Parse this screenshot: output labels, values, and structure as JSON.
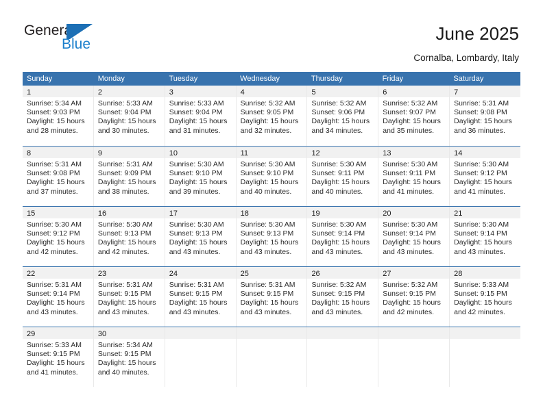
{
  "brand": {
    "name_part1": "General",
    "name_part2": "Blue"
  },
  "header": {
    "title": "June 2025",
    "subtitle": "Cornalba, Lombardy, Italy"
  },
  "colors": {
    "header_blue": "#3873ae",
    "brand_blue": "#1b7fcc",
    "daynum_band": "#f1f1f1",
    "text": "#1a1a1a"
  },
  "calendar": {
    "weekday_headers": [
      "Sunday",
      "Monday",
      "Tuesday",
      "Wednesday",
      "Thursday",
      "Friday",
      "Saturday"
    ],
    "weeks": [
      [
        {
          "day": "1",
          "sunrise": "Sunrise: 5:34 AM",
          "sunset": "Sunset: 9:03 PM",
          "daylight": "Daylight: 15 hours and 28 minutes."
        },
        {
          "day": "2",
          "sunrise": "Sunrise: 5:33 AM",
          "sunset": "Sunset: 9:04 PM",
          "daylight": "Daylight: 15 hours and 30 minutes."
        },
        {
          "day": "3",
          "sunrise": "Sunrise: 5:33 AM",
          "sunset": "Sunset: 9:04 PM",
          "daylight": "Daylight: 15 hours and 31 minutes."
        },
        {
          "day": "4",
          "sunrise": "Sunrise: 5:32 AM",
          "sunset": "Sunset: 9:05 PM",
          "daylight": "Daylight: 15 hours and 32 minutes."
        },
        {
          "day": "5",
          "sunrise": "Sunrise: 5:32 AM",
          "sunset": "Sunset: 9:06 PM",
          "daylight": "Daylight: 15 hours and 34 minutes."
        },
        {
          "day": "6",
          "sunrise": "Sunrise: 5:32 AM",
          "sunset": "Sunset: 9:07 PM",
          "daylight": "Daylight: 15 hours and 35 minutes."
        },
        {
          "day": "7",
          "sunrise": "Sunrise: 5:31 AM",
          "sunset": "Sunset: 9:08 PM",
          "daylight": "Daylight: 15 hours and 36 minutes."
        }
      ],
      [
        {
          "day": "8",
          "sunrise": "Sunrise: 5:31 AM",
          "sunset": "Sunset: 9:08 PM",
          "daylight": "Daylight: 15 hours and 37 minutes."
        },
        {
          "day": "9",
          "sunrise": "Sunrise: 5:31 AM",
          "sunset": "Sunset: 9:09 PM",
          "daylight": "Daylight: 15 hours and 38 minutes."
        },
        {
          "day": "10",
          "sunrise": "Sunrise: 5:30 AM",
          "sunset": "Sunset: 9:10 PM",
          "daylight": "Daylight: 15 hours and 39 minutes."
        },
        {
          "day": "11",
          "sunrise": "Sunrise: 5:30 AM",
          "sunset": "Sunset: 9:10 PM",
          "daylight": "Daylight: 15 hours and 40 minutes."
        },
        {
          "day": "12",
          "sunrise": "Sunrise: 5:30 AM",
          "sunset": "Sunset: 9:11 PM",
          "daylight": "Daylight: 15 hours and 40 minutes."
        },
        {
          "day": "13",
          "sunrise": "Sunrise: 5:30 AM",
          "sunset": "Sunset: 9:11 PM",
          "daylight": "Daylight: 15 hours and 41 minutes."
        },
        {
          "day": "14",
          "sunrise": "Sunrise: 5:30 AM",
          "sunset": "Sunset: 9:12 PM",
          "daylight": "Daylight: 15 hours and 41 minutes."
        }
      ],
      [
        {
          "day": "15",
          "sunrise": "Sunrise: 5:30 AM",
          "sunset": "Sunset: 9:12 PM",
          "daylight": "Daylight: 15 hours and 42 minutes."
        },
        {
          "day": "16",
          "sunrise": "Sunrise: 5:30 AM",
          "sunset": "Sunset: 9:13 PM",
          "daylight": "Daylight: 15 hours and 42 minutes."
        },
        {
          "day": "17",
          "sunrise": "Sunrise: 5:30 AM",
          "sunset": "Sunset: 9:13 PM",
          "daylight": "Daylight: 15 hours and 43 minutes."
        },
        {
          "day": "18",
          "sunrise": "Sunrise: 5:30 AM",
          "sunset": "Sunset: 9:13 PM",
          "daylight": "Daylight: 15 hours and 43 minutes."
        },
        {
          "day": "19",
          "sunrise": "Sunrise: 5:30 AM",
          "sunset": "Sunset: 9:14 PM",
          "daylight": "Daylight: 15 hours and 43 minutes."
        },
        {
          "day": "20",
          "sunrise": "Sunrise: 5:30 AM",
          "sunset": "Sunset: 9:14 PM",
          "daylight": "Daylight: 15 hours and 43 minutes."
        },
        {
          "day": "21",
          "sunrise": "Sunrise: 5:30 AM",
          "sunset": "Sunset: 9:14 PM",
          "daylight": "Daylight: 15 hours and 43 minutes."
        }
      ],
      [
        {
          "day": "22",
          "sunrise": "Sunrise: 5:31 AM",
          "sunset": "Sunset: 9:14 PM",
          "daylight": "Daylight: 15 hours and 43 minutes."
        },
        {
          "day": "23",
          "sunrise": "Sunrise: 5:31 AM",
          "sunset": "Sunset: 9:15 PM",
          "daylight": "Daylight: 15 hours and 43 minutes."
        },
        {
          "day": "24",
          "sunrise": "Sunrise: 5:31 AM",
          "sunset": "Sunset: 9:15 PM",
          "daylight": "Daylight: 15 hours and 43 minutes."
        },
        {
          "day": "25",
          "sunrise": "Sunrise: 5:31 AM",
          "sunset": "Sunset: 9:15 PM",
          "daylight": "Daylight: 15 hours and 43 minutes."
        },
        {
          "day": "26",
          "sunrise": "Sunrise: 5:32 AM",
          "sunset": "Sunset: 9:15 PM",
          "daylight": "Daylight: 15 hours and 43 minutes."
        },
        {
          "day": "27",
          "sunrise": "Sunrise: 5:32 AM",
          "sunset": "Sunset: 9:15 PM",
          "daylight": "Daylight: 15 hours and 42 minutes."
        },
        {
          "day": "28",
          "sunrise": "Sunrise: 5:33 AM",
          "sunset": "Sunset: 9:15 PM",
          "daylight": "Daylight: 15 hours and 42 minutes."
        }
      ],
      [
        {
          "day": "29",
          "sunrise": "Sunrise: 5:33 AM",
          "sunset": "Sunset: 9:15 PM",
          "daylight": "Daylight: 15 hours and 41 minutes."
        },
        {
          "day": "30",
          "sunrise": "Sunrise: 5:34 AM",
          "sunset": "Sunset: 9:15 PM",
          "daylight": "Daylight: 15 hours and 40 minutes."
        },
        {
          "day": "",
          "sunrise": "",
          "sunset": "",
          "daylight": ""
        },
        {
          "day": "",
          "sunrise": "",
          "sunset": "",
          "daylight": ""
        },
        {
          "day": "",
          "sunrise": "",
          "sunset": "",
          "daylight": ""
        },
        {
          "day": "",
          "sunrise": "",
          "sunset": "",
          "daylight": ""
        },
        {
          "day": "",
          "sunrise": "",
          "sunset": "",
          "daylight": ""
        }
      ]
    ]
  }
}
